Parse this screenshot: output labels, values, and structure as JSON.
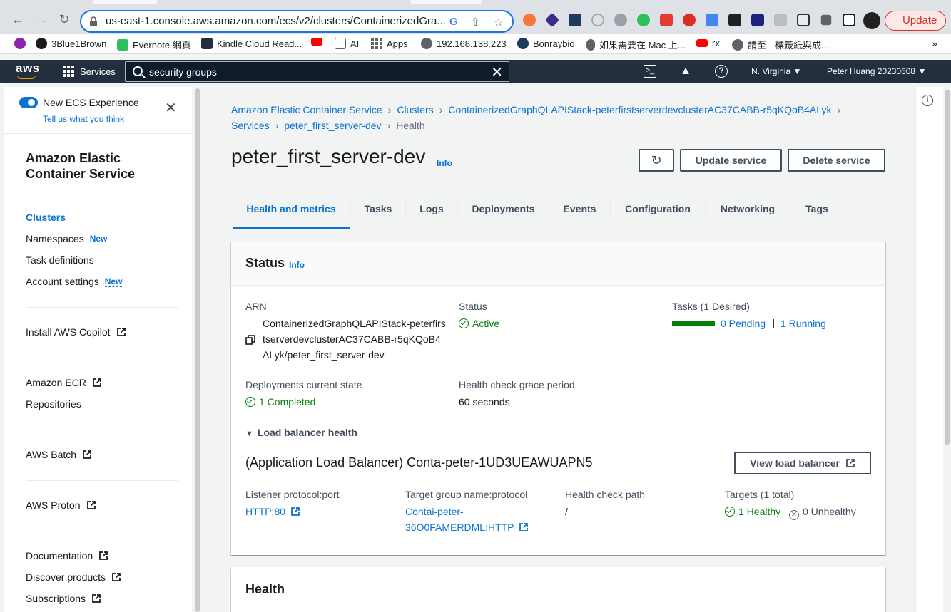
{
  "browser": {
    "url": "us-east-1.console.aws.amazon.com/ecs/v2/clusters/ContainerizedGra...",
    "update_label": "Update",
    "bookmarks": [
      "3Blue1Brown",
      "Evernote 網頁",
      "Kindle Cloud Read...",
      "",
      "AI",
      "Apps",
      "192.168.138.223",
      "Bonraybio",
      "如果需要在 Mac 上...",
      "rx",
      "請至",
      "標籤紙與成..."
    ]
  },
  "aws_header": {
    "logo": "aws",
    "services_label": "Services",
    "search_value": "security groups",
    "region": "N. Virginia",
    "user": "Peter Huang 20230608"
  },
  "sidebar": {
    "toggle_label": "New ECS Experience",
    "feedback_link": "Tell us what you think",
    "title": "Amazon Elastic Container Service",
    "items": [
      {
        "label": "Clusters"
      },
      {
        "label": "Namespaces",
        "badge": "New"
      },
      {
        "label": "Task definitions"
      },
      {
        "label": "Account settings",
        "badge": "New"
      },
      {
        "label": "Install AWS Copilot"
      },
      {
        "label": "Amazon ECR"
      },
      {
        "label": "Repositories"
      },
      {
        "label": "AWS Batch"
      },
      {
        "label": "AWS Proton"
      },
      {
        "label": "Documentation"
      },
      {
        "label": "Discover products"
      },
      {
        "label": "Subscriptions"
      }
    ]
  },
  "breadcrumbs": [
    "Amazon Elastic Container Service",
    "Clusters",
    "ContainerizedGraphQLAPIStack-peterfirstserverdevclusterAC37CABB-r5qKQoB4ALyk",
    "Services",
    "peter_first_server-dev",
    "Health"
  ],
  "page": {
    "title": "peter_first_server-dev",
    "info": "Info",
    "update_button": "Update service",
    "delete_button": "Delete service"
  },
  "tabs": [
    "Health and metrics",
    "Tasks",
    "Logs",
    "Deployments",
    "Events",
    "Configuration",
    "Networking",
    "Tags"
  ],
  "status_panel": {
    "title": "Status",
    "info": "Info",
    "arn_label": "ARN",
    "arn_value": "ContainerizedGraphQLAPIStack-peterfirstserverdevclusterAC37CABB-r5qKQoB4ALyk/peter_first_server-dev",
    "status_label": "Status",
    "status_value": "Active",
    "tasks_label": "Tasks (1 Desired)",
    "tasks_running_fraction": 1.0,
    "pending": "0 Pending",
    "running": "1 Running",
    "deploy_label": "Deployments current state",
    "deploy_value": "1 Completed",
    "grace_label": "Health check grace period",
    "grace_value": "60 seconds",
    "lb_toggle": "Load balancer health",
    "lb_title": "(Application Load Balancer) Conta-peter-1UD3UEAWUAPN5",
    "view_lb_button": "View load balancer",
    "listener_label": "Listener protocol:port",
    "listener_value": "HTTP:80",
    "tg_label": "Target group name:protocol",
    "tg_value_line1": "Contai-peter-",
    "tg_value_line2": "36O0FAMERDML:HTTP",
    "hc_label": "Health check path",
    "hc_value": "/",
    "targets_label": "Targets (1 total)",
    "healthy": "1 Healthy",
    "unhealthy": "0 Unhealthy"
  },
  "health_panel": {
    "title": "Health"
  }
}
